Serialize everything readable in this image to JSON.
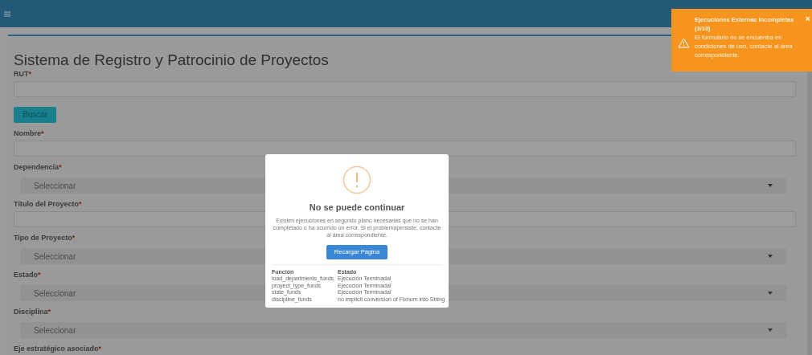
{
  "page": {
    "title": "Sistema de Registro y Patrocinio de Proyectos"
  },
  "form": [
    {
      "kind": "input",
      "label": "RUT",
      "required_mark": "*"
    },
    {
      "kind": "button",
      "label": "Buscar"
    },
    {
      "kind": "input",
      "label": "Nombre",
      "required_mark": "*"
    },
    {
      "kind": "select",
      "label": "Dependencia",
      "required_mark": "*",
      "placeholder": "Seleccionar"
    },
    {
      "kind": "input",
      "label": "Título del Proyecto",
      "required_mark": "*"
    },
    {
      "kind": "select",
      "label": "Tipo de Proyecto",
      "required_mark": "*",
      "placeholder": "Seleccionar"
    },
    {
      "kind": "select",
      "label": "Estado",
      "required_mark": "*",
      "placeholder": "Seleccionar"
    },
    {
      "kind": "select",
      "label": "Disciplina",
      "required_mark": "*",
      "placeholder": "Seleccionar"
    },
    {
      "kind": "label",
      "label": "Eje estratégico asociado",
      "required_mark": "*"
    }
  ],
  "toast": {
    "title": "Ejecuciones Externas Incompletas",
    "count": "(3/10)",
    "message": "El formulario no se encuentra en condiciones de uso, contacte al área correspondiente.",
    "close": "×"
  },
  "dialog": {
    "title": "No se puede continuar",
    "message": "Existen ejecuciones en segundo plano necesarias que no se han completado o ha ocurrido un error. Si el problemapersiste, contacte al área correspondiente.",
    "button": "Recargar Página",
    "columns": [
      "Función",
      "Estado"
    ],
    "rows": [
      [
        "load_departments_funds",
        "Ejecución Terminada!"
      ],
      [
        "proyect_type_funds",
        "Ejecución Terminada!"
      ],
      [
        "state_funds",
        "Ejecución Terminada!"
      ],
      [
        "discipline_funds",
        "no implicit conversion of Fixnum into String"
      ]
    ]
  }
}
